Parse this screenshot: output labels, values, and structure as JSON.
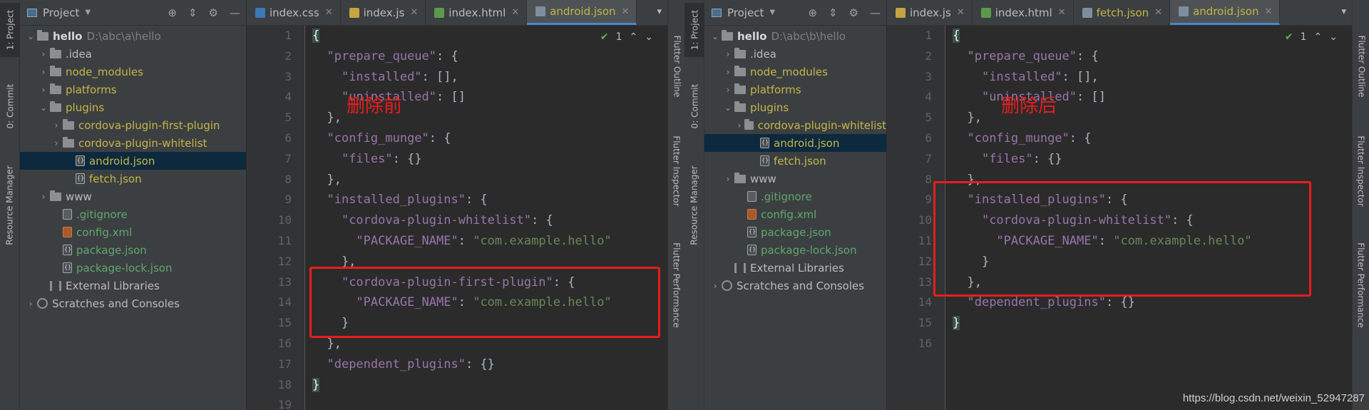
{
  "left_tool_tabs": [
    "1: Project",
    "0: Commit",
    "Resource Manager"
  ],
  "right_tool_tabs": [
    "Flutter Outline",
    "Flutter Inspector",
    "Flutter Performance"
  ],
  "project_header": "Project",
  "panes": [
    {
      "tree": [
        {
          "label": "hello",
          "hint": "D:\\abc\\a\\hello",
          "type": "folder",
          "indent": 0,
          "expanded": true,
          "bold": true
        },
        {
          "label": ".idea",
          "type": "folder",
          "indent": 1,
          "expanded": false
        },
        {
          "label": "node_modules",
          "type": "folder",
          "indent": 1,
          "expanded": false,
          "color": "olive"
        },
        {
          "label": "platforms",
          "type": "folder",
          "indent": 1,
          "expanded": false,
          "color": "olive"
        },
        {
          "label": "plugins",
          "type": "folder",
          "indent": 1,
          "expanded": true,
          "color": "olive"
        },
        {
          "label": "cordova-plugin-first-plugin",
          "type": "folder",
          "indent": 2,
          "expanded": false,
          "color": "olive"
        },
        {
          "label": "cordova-plugin-whitelist",
          "type": "folder",
          "indent": 2,
          "expanded": false,
          "color": "olive"
        },
        {
          "label": "android.json",
          "type": "json",
          "indent": 3,
          "color": "olive",
          "selected": true
        },
        {
          "label": "fetch.json",
          "type": "json",
          "indent": 3,
          "color": "olive"
        },
        {
          "label": "www",
          "type": "folder",
          "indent": 1,
          "expanded": false
        },
        {
          "label": ".gitignore",
          "type": "git",
          "indent": 2,
          "color": "green"
        },
        {
          "label": "config.xml",
          "type": "xml",
          "indent": 2,
          "color": "green"
        },
        {
          "label": "package.json",
          "type": "json",
          "indent": 2,
          "color": "green"
        },
        {
          "label": "package-lock.json",
          "type": "json",
          "indent": 2,
          "color": "green"
        },
        {
          "label": "External Libraries",
          "type": "lib",
          "indent": 1
        },
        {
          "label": "Scratches and Consoles",
          "type": "scratch",
          "indent": 0,
          "expanded": false
        }
      ],
      "tabs": [
        {
          "label": "index.css",
          "icon": "#3a7bb5",
          "active": false,
          "close": true
        },
        {
          "label": "index.js",
          "icon": "#c7a442",
          "active": false,
          "close": true
        },
        {
          "label": "index.html",
          "icon": "#5b9a4d",
          "active": false,
          "close": true
        },
        {
          "label": "android.json",
          "icon": "#7d8e9e",
          "active": true,
          "close": true
        }
      ],
      "check_count": "1",
      "line_numbers": [
        "1",
        "2",
        "3",
        "4",
        "5",
        "6",
        "7",
        "8",
        "9",
        "10",
        "11",
        "12",
        "13",
        "14",
        "15",
        "16",
        "17",
        "18",
        "19"
      ],
      "code": [
        [
          {
            "t": "{",
            "c": "hl"
          }
        ],
        [
          {
            "t": "  "
          },
          {
            "t": "\"prepare_queue\"",
            "c": "k"
          },
          {
            "t": ": {"
          }
        ],
        [
          {
            "t": "    "
          },
          {
            "t": "\"installed\"",
            "c": "k"
          },
          {
            "t": ": [],"
          }
        ],
        [
          {
            "t": "    "
          },
          {
            "t": "\"uninstalled\"",
            "c": "k"
          },
          {
            "t": ": []"
          }
        ],
        [
          {
            "t": "  },"
          }
        ],
        [
          {
            "t": "  "
          },
          {
            "t": "\"config_munge\"",
            "c": "k"
          },
          {
            "t": ": {"
          }
        ],
        [
          {
            "t": "    "
          },
          {
            "t": "\"files\"",
            "c": "k"
          },
          {
            "t": ": {}"
          }
        ],
        [
          {
            "t": "  },"
          }
        ],
        [
          {
            "t": "  "
          },
          {
            "t": "\"installed_plugins\"",
            "c": "k"
          },
          {
            "t": ": {"
          }
        ],
        [
          {
            "t": "    "
          },
          {
            "t": "\"cordova-plugin-whitelist\"",
            "c": "k"
          },
          {
            "t": ": {"
          }
        ],
        [
          {
            "t": "      "
          },
          {
            "t": "\"PACKAGE_NAME\"",
            "c": "k"
          },
          {
            "t": ": "
          },
          {
            "t": "\"com.example.hello\"",
            "c": "s"
          }
        ],
        [
          {
            "t": "    },"
          }
        ],
        [
          {
            "t": "    "
          },
          {
            "t": "\"cordova-plugin-first-plugin\"",
            "c": "k"
          },
          {
            "t": ": {"
          }
        ],
        [
          {
            "t": "      "
          },
          {
            "t": "\"PACKAGE_NAME\"",
            "c": "k"
          },
          {
            "t": ": "
          },
          {
            "t": "\"com.example.hello\"",
            "c": "s"
          }
        ],
        [
          {
            "t": "    }"
          }
        ],
        [
          {
            "t": "  },"
          }
        ],
        [
          {
            "t": "  "
          },
          {
            "t": "\"dependent_plugins\"",
            "c": "k"
          },
          {
            "t": ": {}"
          }
        ],
        [
          {
            "t": "}",
            "c": "hl"
          }
        ],
        [
          {
            "t": ""
          }
        ]
      ],
      "annotation": "删除前"
    },
    {
      "tree": [
        {
          "label": "hello",
          "hint": "D:\\abc\\b\\hello",
          "type": "folder",
          "indent": 0,
          "expanded": true,
          "bold": true
        },
        {
          "label": ".idea",
          "type": "folder",
          "indent": 1,
          "expanded": false
        },
        {
          "label": "node_modules",
          "type": "folder",
          "indent": 1,
          "expanded": false,
          "color": "olive"
        },
        {
          "label": "platforms",
          "type": "folder",
          "indent": 1,
          "expanded": false,
          "color": "olive"
        },
        {
          "label": "plugins",
          "type": "folder",
          "indent": 1,
          "expanded": true,
          "color": "olive"
        },
        {
          "label": "cordova-plugin-whitelist",
          "type": "folder",
          "indent": 2,
          "expanded": false,
          "color": "olive"
        },
        {
          "label": "android.json",
          "type": "json",
          "indent": 3,
          "color": "olive",
          "selected": true
        },
        {
          "label": "fetch.json",
          "type": "json",
          "indent": 3,
          "color": "olive"
        },
        {
          "label": "www",
          "type": "folder",
          "indent": 1,
          "expanded": false
        },
        {
          "label": ".gitignore",
          "type": "git",
          "indent": 2,
          "color": "green"
        },
        {
          "label": "config.xml",
          "type": "xml",
          "indent": 2,
          "color": "green"
        },
        {
          "label": "package.json",
          "type": "json",
          "indent": 2,
          "color": "green"
        },
        {
          "label": "package-lock.json",
          "type": "json",
          "indent": 2,
          "color": "green"
        },
        {
          "label": "External Libraries",
          "type": "lib",
          "indent": 1
        },
        {
          "label": "Scratches and Consoles",
          "type": "scratch",
          "indent": 0,
          "expanded": false
        }
      ],
      "tabs": [
        {
          "label": "index.js",
          "icon": "#c7a442",
          "active": false,
          "close": true
        },
        {
          "label": "index.html",
          "icon": "#5b9a4d",
          "active": false,
          "close": true
        },
        {
          "label": "fetch.json",
          "icon": "#7d8e9e",
          "active": false,
          "close": true,
          "olive": true
        },
        {
          "label": "android.json",
          "icon": "#7d8e9e",
          "active": true,
          "close": true
        }
      ],
      "check_count": "1",
      "line_numbers": [
        "1",
        "2",
        "3",
        "4",
        "5",
        "6",
        "7",
        "8",
        "9",
        "10",
        "11",
        "12",
        "13",
        "14",
        "15",
        "16"
      ],
      "code": [
        [
          {
            "t": "{",
            "c": "hl"
          }
        ],
        [
          {
            "t": "  "
          },
          {
            "t": "\"prepare_queue\"",
            "c": "k"
          },
          {
            "t": ": {"
          }
        ],
        [
          {
            "t": "    "
          },
          {
            "t": "\"installed\"",
            "c": "k"
          },
          {
            "t": ": [],"
          }
        ],
        [
          {
            "t": "    "
          },
          {
            "t": "\"uninstalled\"",
            "c": "k"
          },
          {
            "t": ": []"
          }
        ],
        [
          {
            "t": "  },"
          }
        ],
        [
          {
            "t": "  "
          },
          {
            "t": "\"config_munge\"",
            "c": "k"
          },
          {
            "t": ": {"
          }
        ],
        [
          {
            "t": "    "
          },
          {
            "t": "\"files\"",
            "c": "k"
          },
          {
            "t": ": {}"
          }
        ],
        [
          {
            "t": "  },"
          }
        ],
        [
          {
            "t": "  "
          },
          {
            "t": "\"installed_plugins\"",
            "c": "k"
          },
          {
            "t": ": {"
          }
        ],
        [
          {
            "t": "    "
          },
          {
            "t": "\"cordova-plugin-whitelist\"",
            "c": "k"
          },
          {
            "t": ": {"
          }
        ],
        [
          {
            "t": "      "
          },
          {
            "t": "\"PACKAGE_NAME\"",
            "c": "k"
          },
          {
            "t": ": "
          },
          {
            "t": "\"com.example.hello\"",
            "c": "s"
          }
        ],
        [
          {
            "t": "    }"
          }
        ],
        [
          {
            "t": "  },"
          }
        ],
        [
          {
            "t": "  "
          },
          {
            "t": "\"dependent_plugins\"",
            "c": "k"
          },
          {
            "t": ": {}"
          }
        ],
        [
          {
            "t": "}",
            "c": "hl"
          }
        ],
        [
          {
            "t": ""
          }
        ]
      ],
      "annotation": "删除后"
    }
  ],
  "watermark": "https://blog.csdn.net/weixin_52947287",
  "colors": {
    "annotation_red": "#e81d1d",
    "key_purple": "#9876aa",
    "string_green": "#6a8759",
    "selection": "#0d293e"
  }
}
